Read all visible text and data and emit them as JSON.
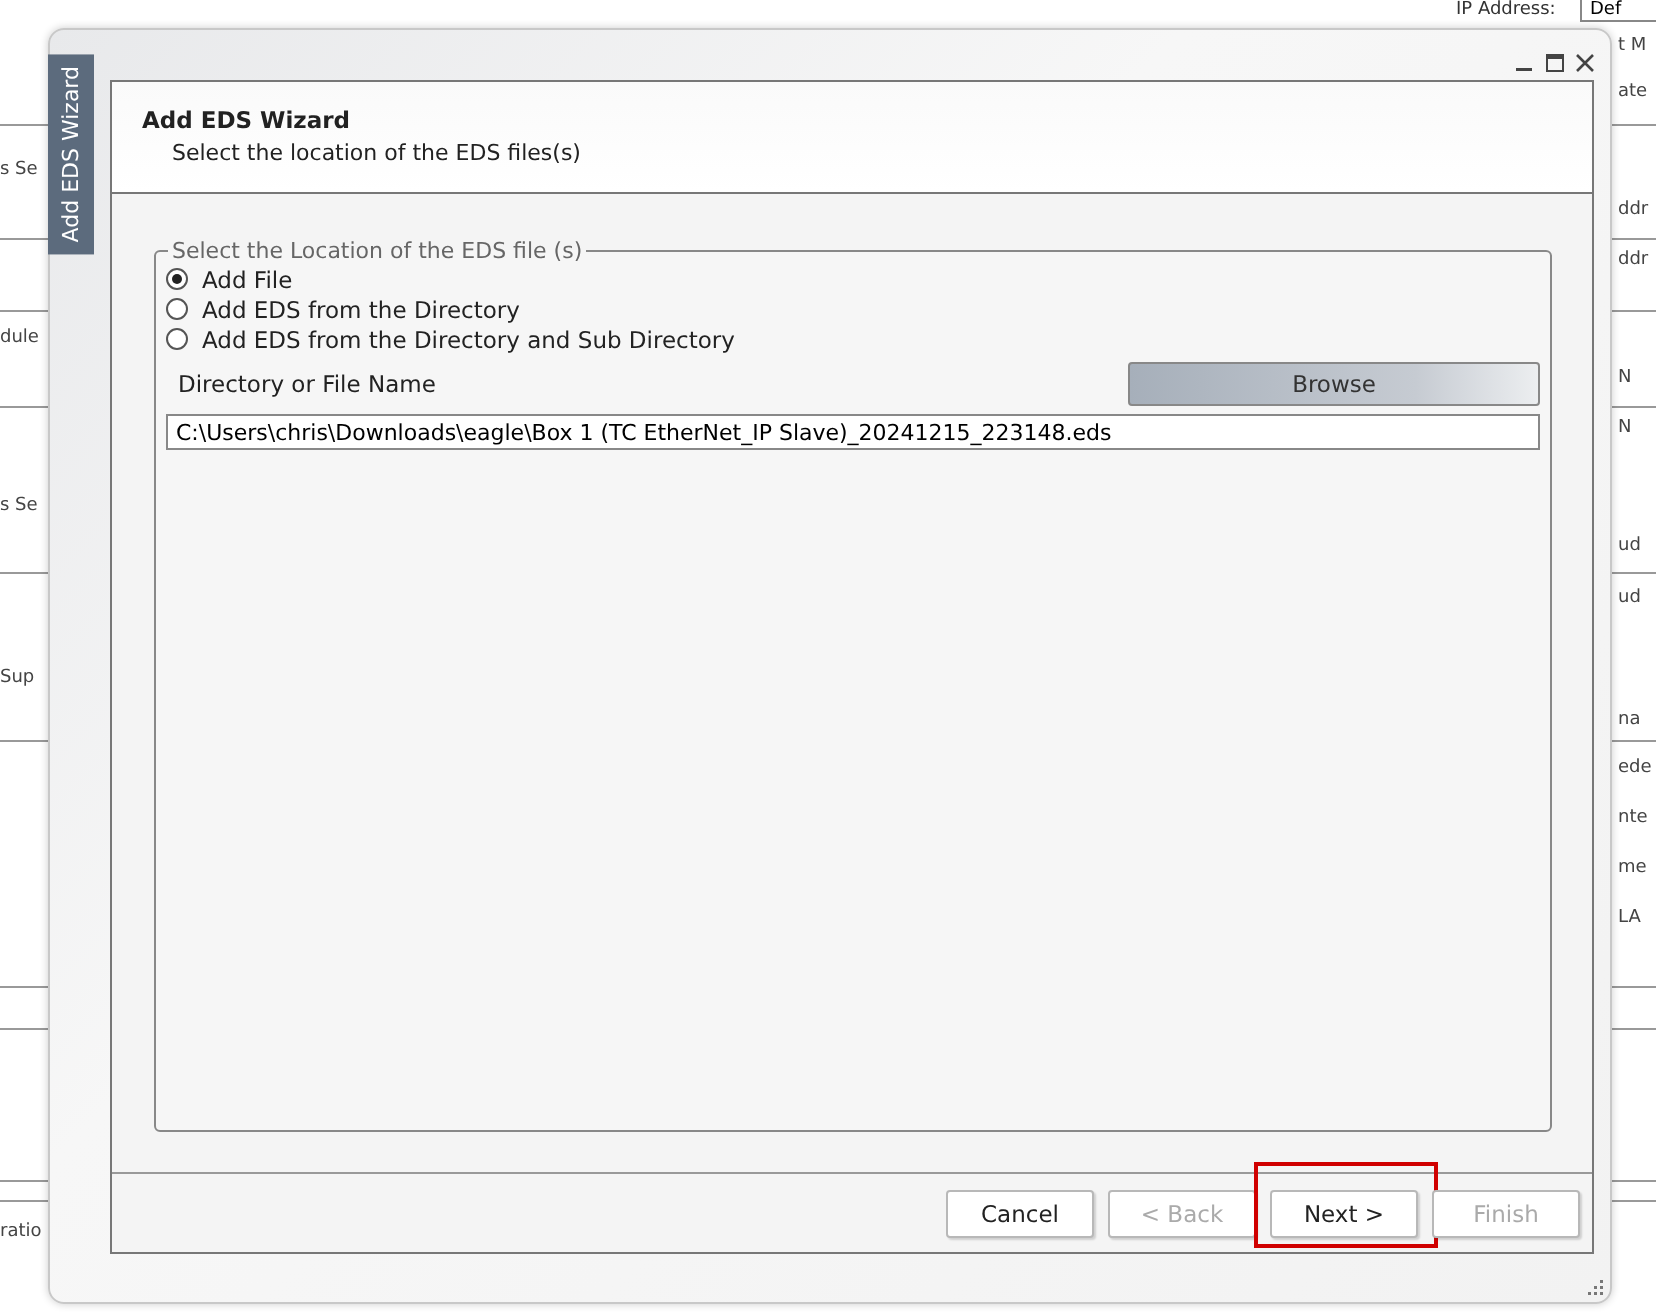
{
  "background": {
    "top_label": "IP Address:",
    "top_button": "Def",
    "left_fragments": [
      "s Se",
      "dule",
      "s Se",
      "Sup",
      "ratio"
    ],
    "right_fragments": [
      "t M",
      "ate",
      "ddr",
      "ddr",
      "N",
      "N",
      "ud",
      "ud",
      "na",
      "ede",
      "nte",
      "me",
      "LA"
    ]
  },
  "window": {
    "side_tab": "Add EDS Wizard",
    "title": "Add EDS Wizard",
    "subtitle": "Select the location of the EDS files(s)"
  },
  "group": {
    "legend": "Select the Location of the EDS file (s)",
    "options": [
      {
        "label": "Add File",
        "selected": true
      },
      {
        "label": "Add EDS from the Directory",
        "selected": false
      },
      {
        "label": "Add EDS from the Directory and Sub Directory",
        "selected": false
      }
    ],
    "field_label": "Directory or File Name",
    "browse_button": "Browse",
    "path_value": "C:\\Users\\chris\\Downloads\\eagle\\Box 1 (TC EtherNet_IP Slave)_20241215_223148.eds"
  },
  "buttons": [
    {
      "label": "Cancel",
      "disabled": false,
      "highlighted": false
    },
    {
      "label": "< Back",
      "disabled": true,
      "highlighted": false
    },
    {
      "label": "Next >",
      "disabled": false,
      "highlighted": true
    },
    {
      "label": "Finish",
      "disabled": true,
      "highlighted": false
    }
  ]
}
